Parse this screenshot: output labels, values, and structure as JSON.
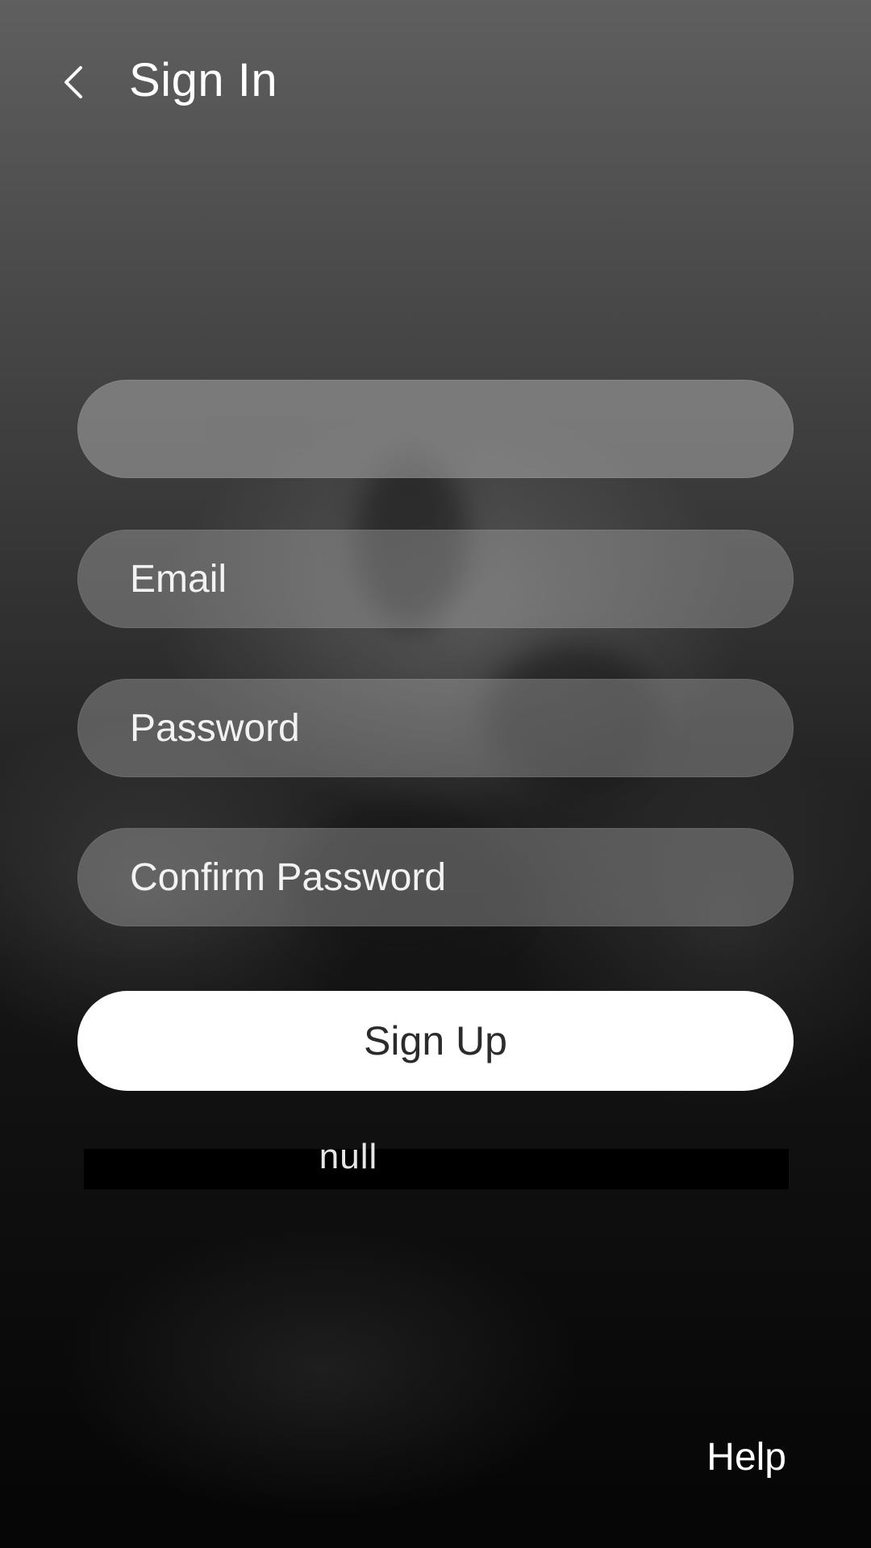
{
  "header": {
    "back_icon": "chevron-left-icon",
    "title": "Sign In"
  },
  "form": {
    "field_1": {
      "placeholder": ""
    },
    "email": {
      "placeholder": "Email"
    },
    "password": {
      "placeholder": "Password"
    },
    "confirm_password": {
      "placeholder": "Confirm Password"
    },
    "submit_label": "Sign Up"
  },
  "status": {
    "text": "null"
  },
  "footer": {
    "help_label": "Help"
  },
  "colors": {
    "button_bg": "#ffffff",
    "button_text": "#2b2b2b",
    "field_bg": "rgba(180,180,180,0.38)"
  }
}
